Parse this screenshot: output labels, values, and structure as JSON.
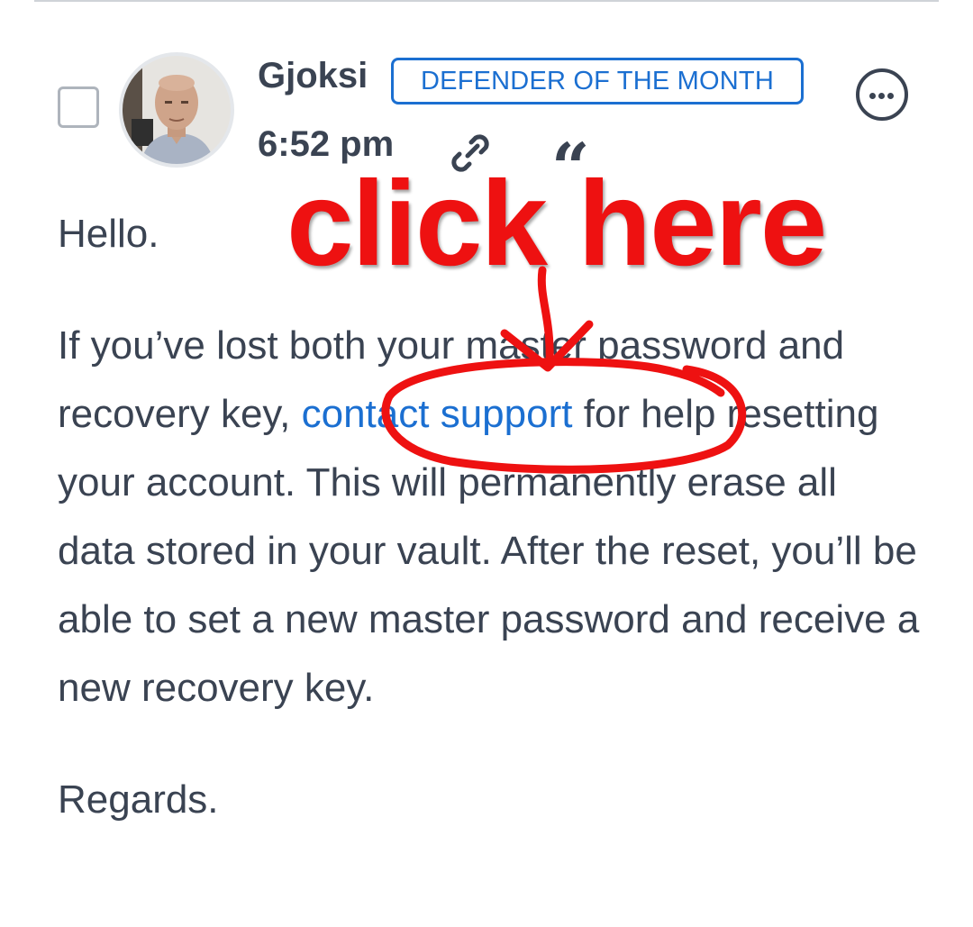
{
  "post": {
    "author": "Gjoksi",
    "badge": "DEFENDER OF THE MONTH",
    "time": "6:52 pm",
    "icons": {
      "more": "more-horizontal-icon",
      "permalink": "link-icon",
      "quote": "quote-icon",
      "quote_glyph": "“"
    },
    "body": {
      "greeting": "Hello.",
      "p2_before": "If you’ve lost both your master password and recovery key, ",
      "link_text": "contact support",
      "p2_after": " for help resetting your account. This will permanently erase all data stored in your vault. After the reset, you’ll be able to set a new master password and receive a new recovery key.",
      "signoff": "Regards."
    }
  },
  "annotation": {
    "text": "click here",
    "color": "#ee1111"
  },
  "colors": {
    "link": "#1b6fd1",
    "text": "#3a4352",
    "badge": "#1b6fd1"
  }
}
